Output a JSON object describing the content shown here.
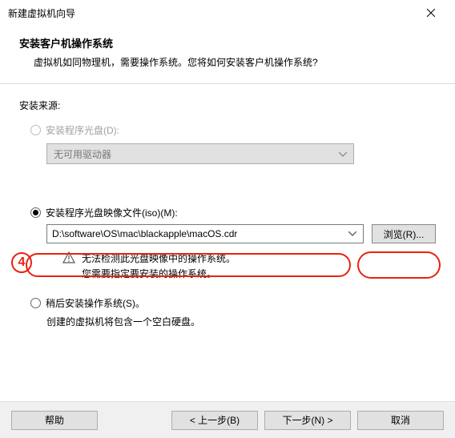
{
  "titlebar": {
    "title": "新建虚拟机向导"
  },
  "header": {
    "title": "安装客户机操作系统",
    "desc": "虚拟机如同物理机，需要操作系统。您将如何安装客户机操作系统?"
  },
  "source_label": "安装来源:",
  "radios": {
    "disc": {
      "label": "安装程序光盘(D):"
    },
    "disc_combo": {
      "value": "无可用驱动器"
    },
    "iso": {
      "label": "安装程序光盘映像文件(iso)(M):"
    },
    "iso_value": "D:\\software\\OS\\mac\\blackapple\\macOS.cdr",
    "browse_label": "浏览(R)...",
    "warn_line1": "无法检测此光盘映像中的操作系统。",
    "warn_line2": "您需要指定要安装的操作系统。",
    "later": {
      "label": "稍后安装操作系统(S)。"
    },
    "later_hint": "创建的虚拟机将包含一个空白硬盘。"
  },
  "badge": "4",
  "footer": {
    "help": "帮助",
    "back": "< 上一步(B)",
    "next": "下一步(N) >",
    "cancel": "取消"
  }
}
